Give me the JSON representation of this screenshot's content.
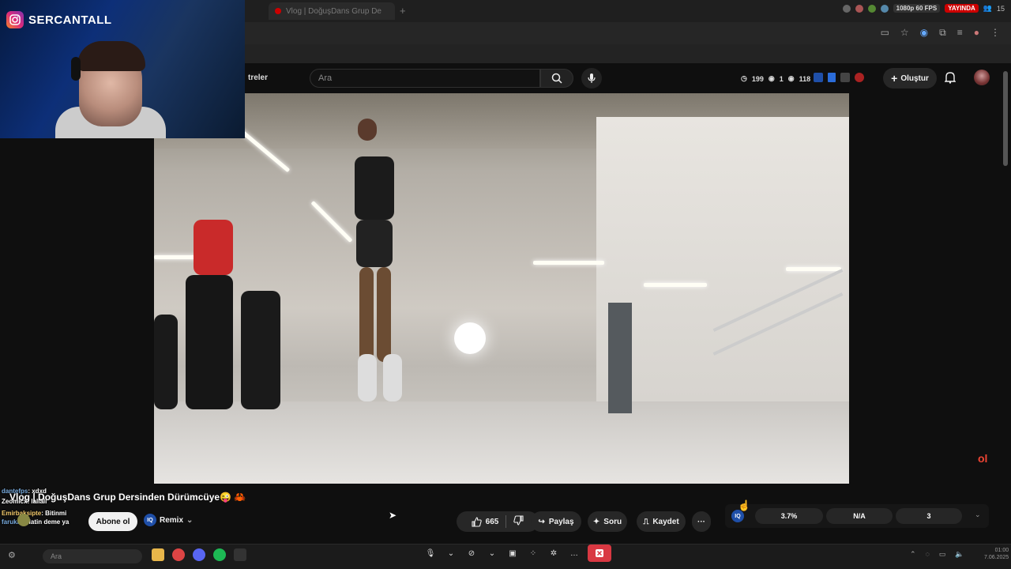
{
  "browser": {
    "tab_title": "Vlog | DoğuşDans Grup De",
    "new_tab_symbol": "+",
    "badges": {
      "fps": "1080p 60 FPS",
      "live": "YAYINDA"
    },
    "tray_count": "15"
  },
  "youtube": {
    "nav_fragment": "treler",
    "search_placeholder": "Ara",
    "stats": {
      "clock": "199",
      "eye1": "1",
      "eye2": "118"
    },
    "create_label": "Oluştur",
    "video_title": "Vlog | DoğuşDans Grup Dersinden Dürümcüye😜 🦀",
    "subscribe_label": "Abone ol",
    "remix_label": "Remix",
    "remix_icon_text": "IQ",
    "like_count": "665",
    "share_label": "Paylaş",
    "ask_label": "Soru",
    "save_label": "Kaydet",
    "more_label": "···"
  },
  "extension": {
    "logo_text": "IQ",
    "cells": [
      "3.7%",
      "N/A",
      "3"
    ],
    "chevron": "⌄"
  },
  "overlay": {
    "instagram_name": "SERCANTALL",
    "chat": [
      {
        "user": "dantefps",
        "msg": ": xdxd"
      },
      {
        "user": "Zeomicx",
        "msg": ": lallali"
      },
      {
        "user": "Emirbaksipte",
        "msg": ": Bitinmi"
      },
      {
        "user": "farukkK",
        "msg": ": latin deme ya"
      }
    ],
    "corner_logo": "ol"
  },
  "taskbar": {
    "search_placeholder": "Ara",
    "clock_time": "01:00",
    "clock_date": "7.06.2025"
  },
  "colors": {
    "accent_red": "#d93842",
    "ext_blue": "#1f4fa8"
  }
}
